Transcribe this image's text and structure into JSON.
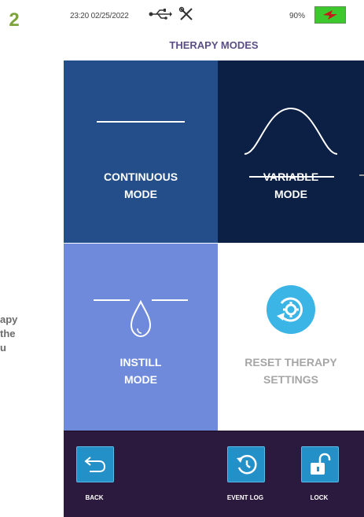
{
  "step_number": "2",
  "side_text": [
    "apy",
    "the",
    "u"
  ],
  "status": {
    "datetime": "23:20 02/25/2022",
    "battery": "90%"
  },
  "title": "THERAPY MODES",
  "tiles": {
    "continuous": {
      "line1": "CONTINUOUS",
      "line2": "MODE",
      "icon": "flat-line-icon"
    },
    "variable": {
      "line1": "VARIABLE",
      "line2": "MODE",
      "icon": "sine-wave-icon"
    },
    "instill": {
      "line1": "INSTILL",
      "line2": "MODE",
      "icon": "droplet-icon"
    },
    "reset": {
      "line1": "RESET THERAPY",
      "line2": "SETTINGS",
      "icon": "reset-gear-icon"
    }
  },
  "bottom_bar": {
    "back": "BACK",
    "event_log": "EVENT LOG",
    "lock": "LOCK"
  },
  "colors": {
    "continuous_tile": "#234e8a",
    "variable_tile": "#0c1f44",
    "instill_tile": "#6f8adb",
    "button_blue": "#2490c8",
    "bottom_bar": "#2c1a3e",
    "title": "#5b4f86",
    "step_number": "#7da33b"
  }
}
